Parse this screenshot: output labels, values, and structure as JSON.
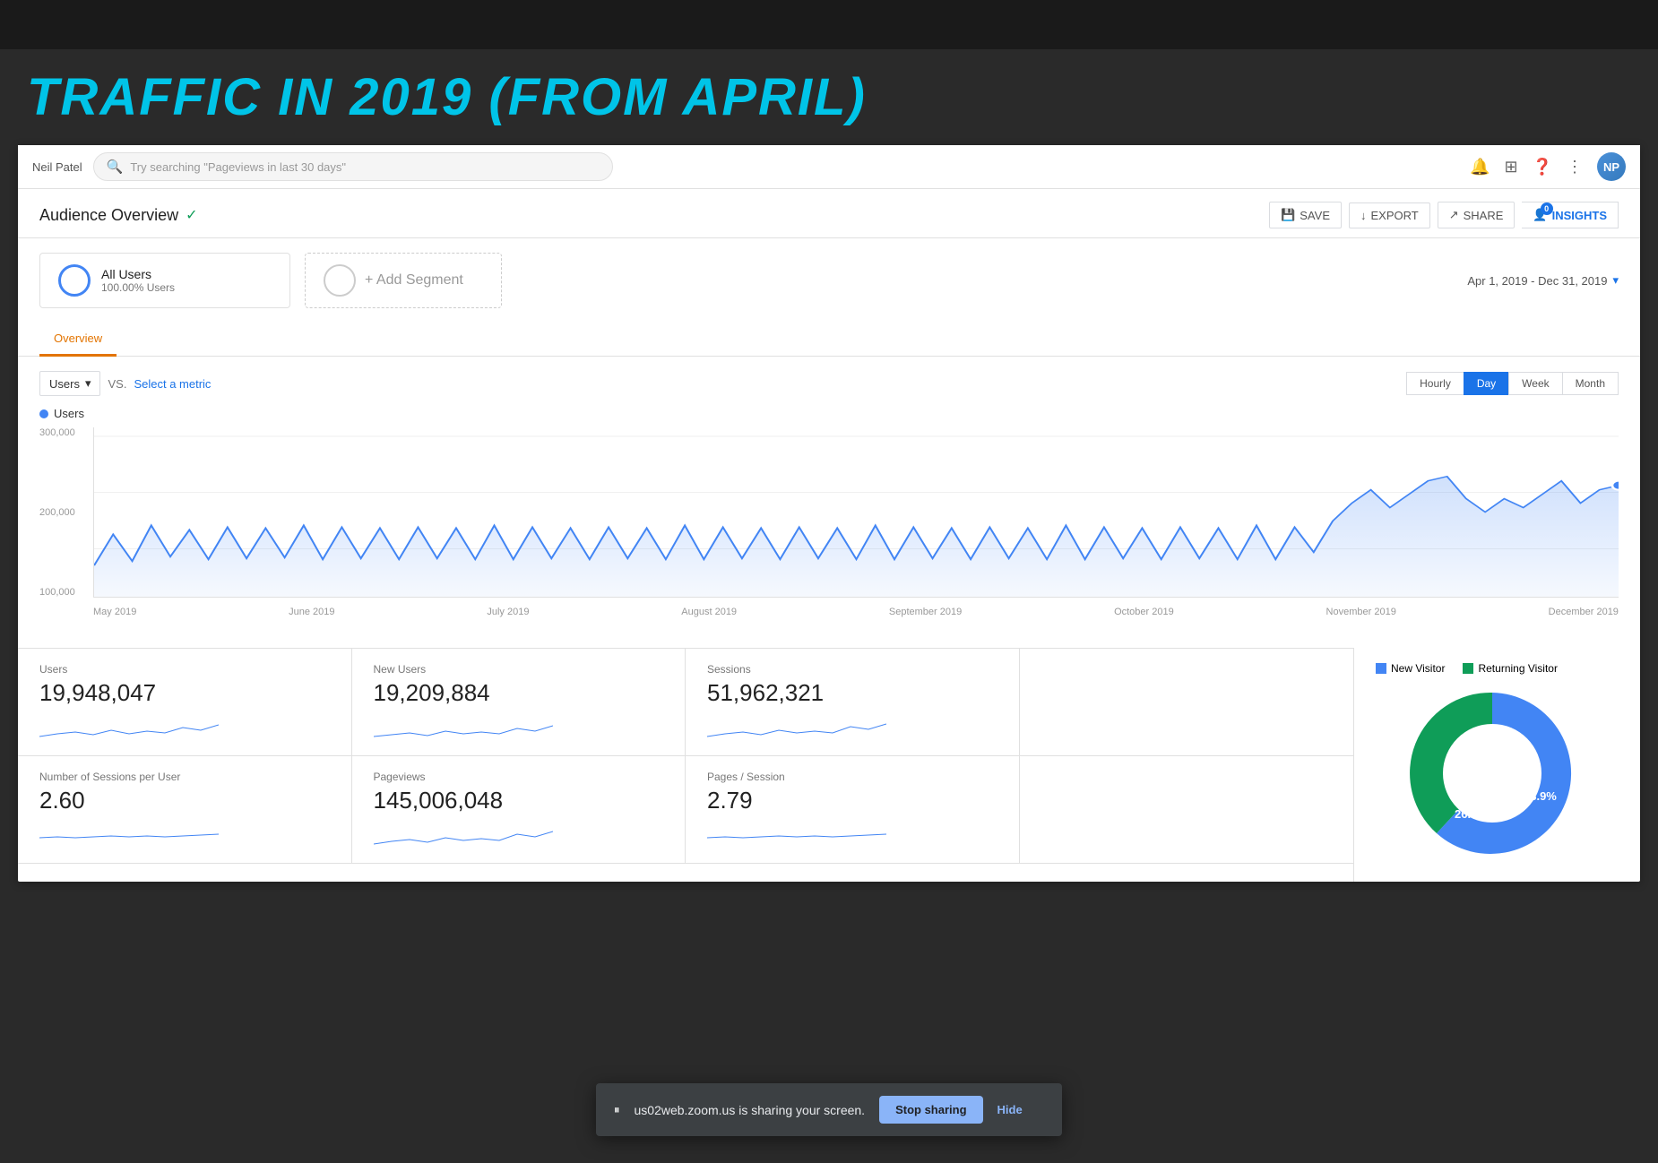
{
  "page": {
    "title": "TRAFFIC IN 2019 (FROM APRIL)"
  },
  "nav": {
    "brand": "Neil Patel",
    "search_placeholder": "Try searching \"Pageviews in last 30 days\"",
    "icons": [
      "bell",
      "apps",
      "help",
      "more-vert"
    ],
    "avatar_label": "NP"
  },
  "audience_overview": {
    "title": "Audience Overview",
    "verified": "✓",
    "actions": {
      "save": "SAVE",
      "export": "EXPORT",
      "share": "SHARE",
      "insights": "INSIGHTS",
      "insights_count": "0"
    },
    "date_range": "Apr 1, 2019 - Dec 31, 2019"
  },
  "segments": {
    "all_users": {
      "name": "All Users",
      "pct": "100.00% Users"
    },
    "add_label": "+ Add Segment"
  },
  "tabs": [
    {
      "label": "Overview",
      "active": true
    }
  ],
  "chart": {
    "metric_label": "Users",
    "vs_label": "VS.",
    "select_metric": "Select a metric",
    "time_buttons": [
      "Hourly",
      "Day",
      "Week",
      "Month"
    ],
    "active_time": "Day",
    "legend_label": "Users",
    "y_labels": [
      "300,000",
      "200,000",
      "100,000"
    ],
    "x_labels": [
      "May 2019",
      "June 2019",
      "July 2019",
      "August 2019",
      "September 2019",
      "October 2019",
      "November 2019",
      "December 2019"
    ]
  },
  "stats": [
    {
      "label": "Users",
      "value": "19,948,047"
    },
    {
      "label": "New Users",
      "value": "19,209,884"
    },
    {
      "label": "Sessions",
      "value": "51,962,321"
    },
    {
      "label": "",
      "value": ""
    },
    {
      "label": "Number of Sessions per User",
      "value": "2.60"
    },
    {
      "label": "Pageviews",
      "value": "145,006,048"
    },
    {
      "label": "Pages / Session",
      "value": "2.79"
    }
  ],
  "pie_chart": {
    "new_visitor_label": "New Visitor",
    "returning_visitor_label": "Returning Visitor",
    "new_visitor_pct": "73.9%",
    "returning_visitor_pct": "26.1%",
    "new_visitor_color": "#4285f4",
    "returning_visitor_color": "#0f9d58"
  },
  "notification": {
    "pause_icon": "⏸",
    "text": "us02web.zoom.us is sharing your screen.",
    "stop_btn": "Stop sharing",
    "hide_btn": "Hide"
  }
}
